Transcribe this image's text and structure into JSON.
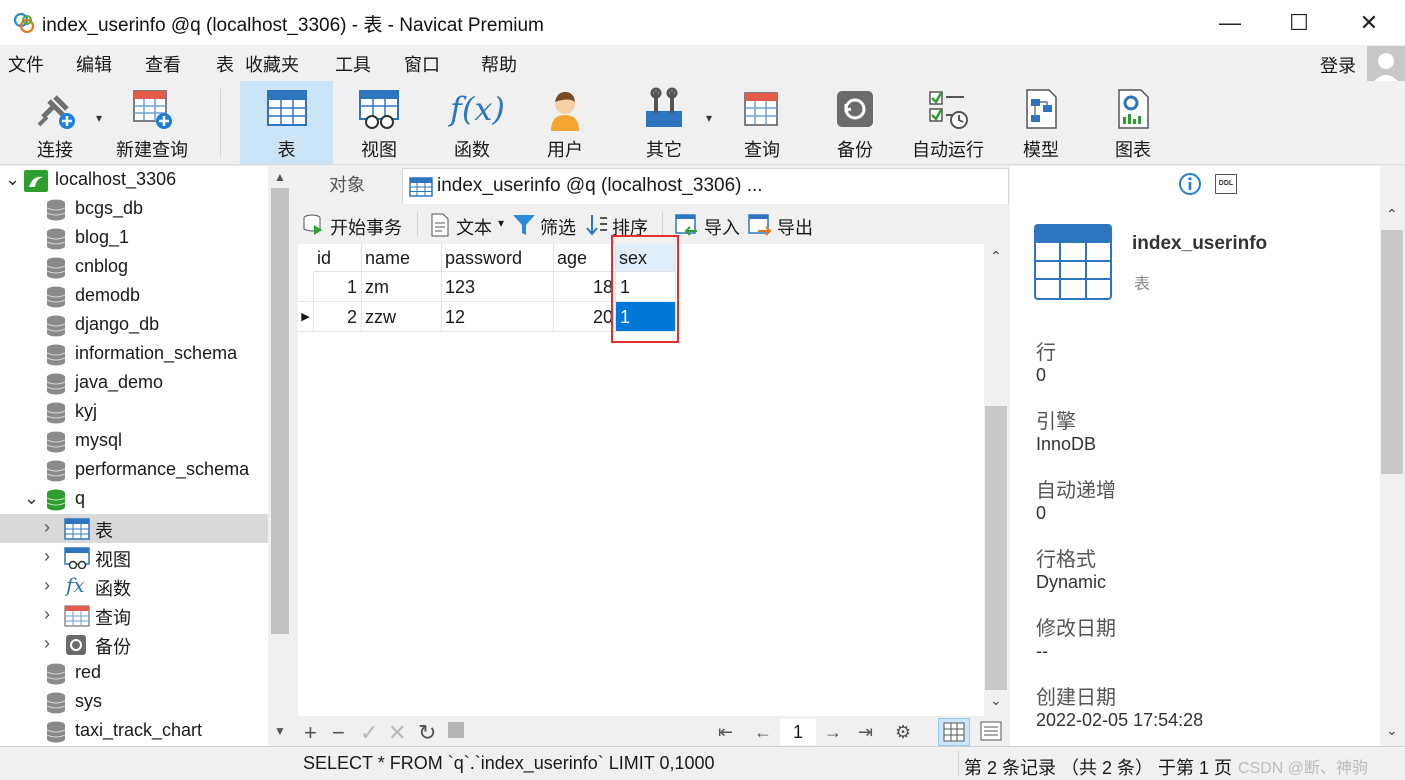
{
  "window": {
    "title": "index_userinfo @q (localhost_3306) - 表 - Navicat Premium",
    "minimize": "—",
    "maximize": "☐",
    "close": "✕"
  },
  "menu": {
    "items": [
      "文件",
      "编辑",
      "查看",
      "表",
      "收藏夹",
      "工具",
      "窗口",
      "帮助"
    ],
    "login": "登录"
  },
  "toolbar": {
    "connect": "连接",
    "new_query": "新建查询",
    "table": "表",
    "view": "视图",
    "function": "函数",
    "user": "用户",
    "other": "其它",
    "query": "查询",
    "backup": "备份",
    "auto_run": "自动运行",
    "model": "模型",
    "chart": "图表"
  },
  "tree": {
    "connection": "localhost_3306",
    "databases": [
      "bcgs_db",
      "blog_1",
      "cnblog",
      "demodb",
      "django_db",
      "information_schema",
      "java_demo",
      "kyj",
      "mysql",
      "performance_schema"
    ],
    "open_db": "q",
    "children": [
      "表",
      "视图",
      "函数",
      "查询",
      "备份"
    ],
    "more_databases": [
      "red",
      "sys",
      "taxi_track_chart"
    ]
  },
  "tabs": {
    "objects": "对象",
    "doc": "index_userinfo @q (localhost_3306) ..."
  },
  "subtoolbar": {
    "begin_tx": "开始事务",
    "text": "文本",
    "filter": "筛选",
    "sort": "排序",
    "import": "导入",
    "export": "导出"
  },
  "grid": {
    "columns": [
      "id",
      "name",
      "password",
      "age",
      "sex"
    ],
    "rows": [
      {
        "id": "1",
        "name": "zm",
        "password": "123",
        "age": "18",
        "sex": "1"
      },
      {
        "id": "2",
        "name": "zzw",
        "password": "12",
        "age": "20",
        "sex": "1"
      }
    ],
    "page": "1"
  },
  "info": {
    "name": "index_userinfo",
    "kind": "表",
    "fields": [
      {
        "label": "行",
        "value": "0"
      },
      {
        "label": "引擎",
        "value": "InnoDB"
      },
      {
        "label": "自动递增",
        "value": "0"
      },
      {
        "label": "行格式",
        "value": "Dynamic"
      },
      {
        "label": "修改日期",
        "value": "--"
      },
      {
        "label": "创建日期",
        "value": "2022-02-05 17:54:28"
      }
    ]
  },
  "status": {
    "sql": "SELECT * FROM `q`.`index_userinfo` LIMIT 0,1000",
    "record": "第 2 条记录 （共 2 条） 于第 1 页",
    "watermark": "CSDN @断、神驹"
  },
  "colors": {
    "accent": "#0078d7",
    "toolbar_active": "#cce4f7",
    "highlight_box": "#e03030",
    "db_green": "#2e9e2e"
  }
}
